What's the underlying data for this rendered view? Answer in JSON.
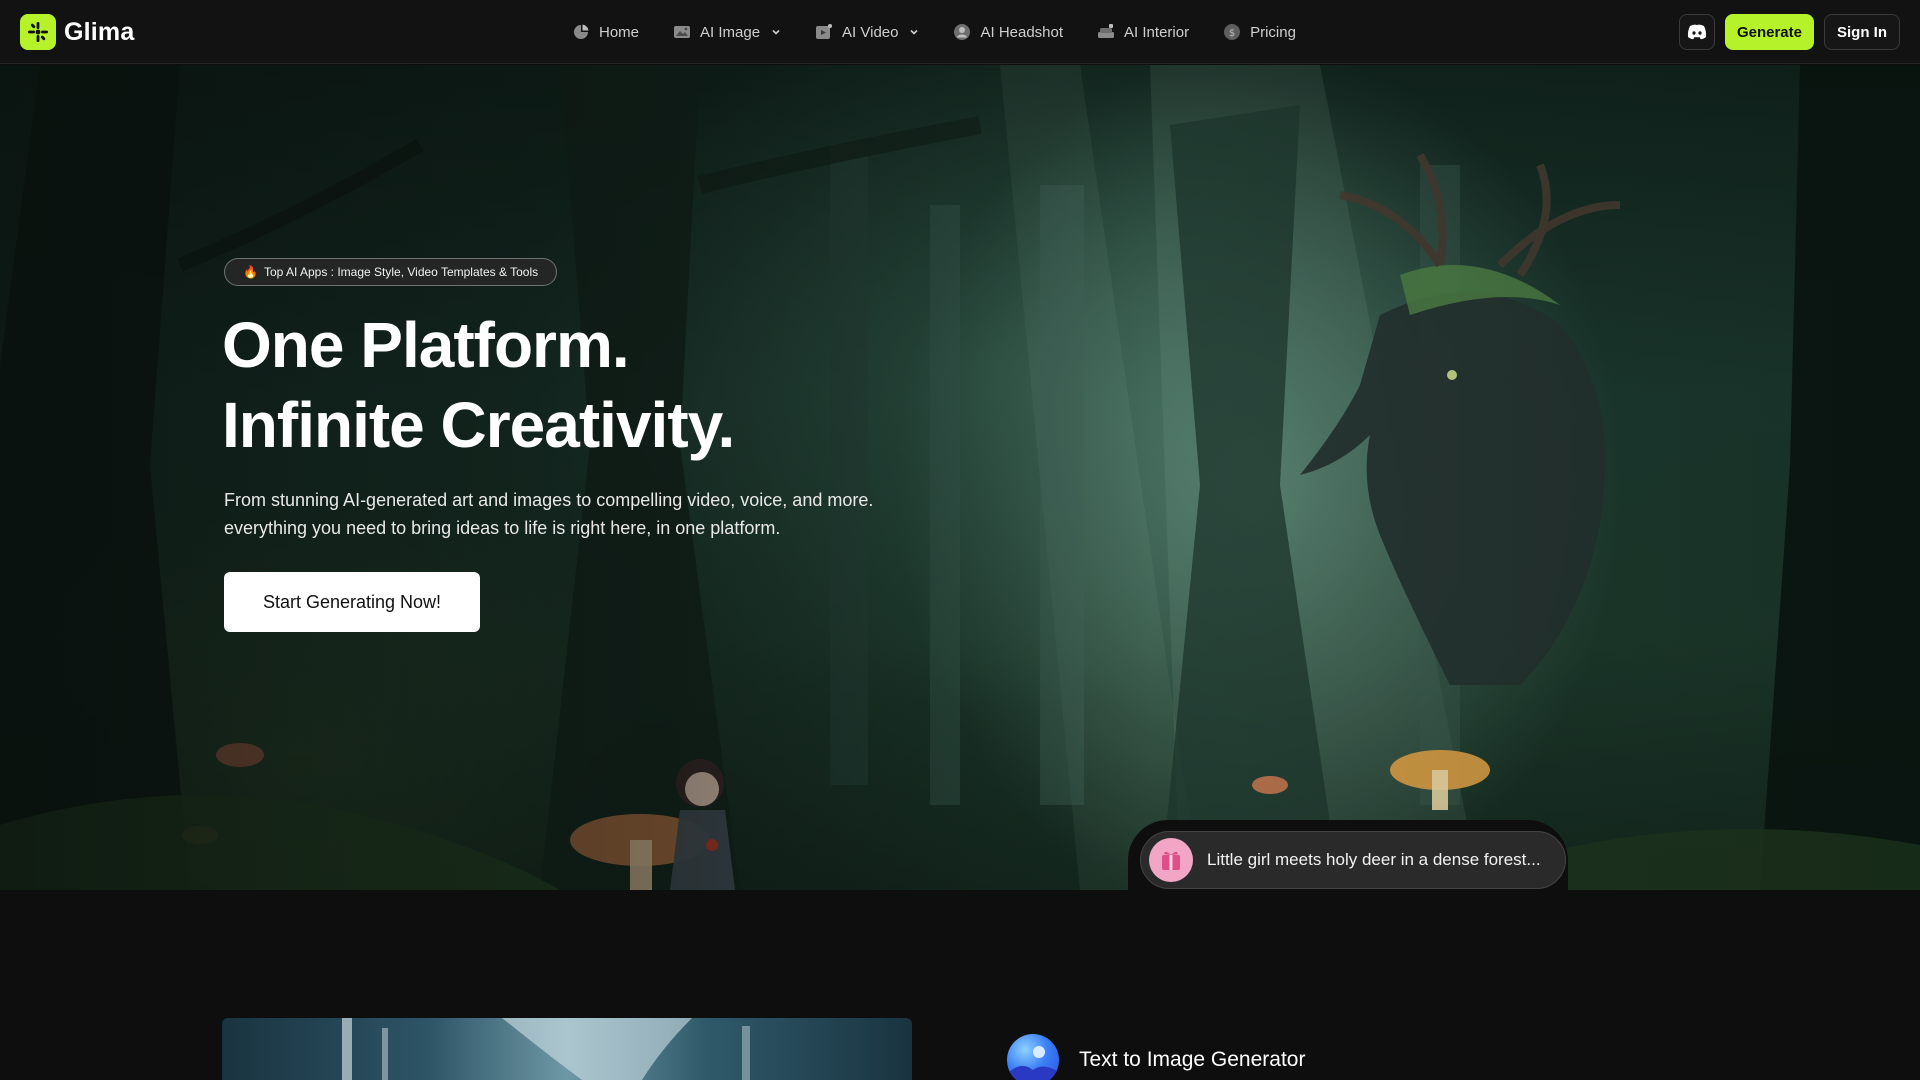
{
  "brand": {
    "name": "Glima",
    "accent": "#b6f22a"
  },
  "nav": {
    "items": [
      {
        "label": "Home",
        "icon": "home-icon",
        "dropdown": false
      },
      {
        "label": "AI Image",
        "icon": "image-icon",
        "dropdown": true
      },
      {
        "label": "AI Video",
        "icon": "video-icon",
        "dropdown": true
      },
      {
        "label": "AI Headshot",
        "icon": "headshot-icon",
        "dropdown": false
      },
      {
        "label": "AI Interior",
        "icon": "interior-icon",
        "dropdown": false
      },
      {
        "label": "Pricing",
        "icon": "pricing-icon",
        "dropdown": false
      }
    ],
    "discord_icon": "discord-icon",
    "generate_label": "Generate",
    "signin_label": "Sign In"
  },
  "hero": {
    "badge_emoji": "🔥",
    "badge_text": "Top AI Apps : Image Style, Video Templates & Tools",
    "headline_line1": "One Platform.",
    "headline_line2": "Infinite Creativity.",
    "subtext": "From stunning AI-generated art and images to compelling video, voice, and more. everything you need to bring ideas to life is right here, in one platform.",
    "cta_label": "Start Generating Now!",
    "prompt_text": "Little girl meets holy deer in a dense forest..."
  },
  "features": {
    "first_title": "Text to Image Generator"
  }
}
